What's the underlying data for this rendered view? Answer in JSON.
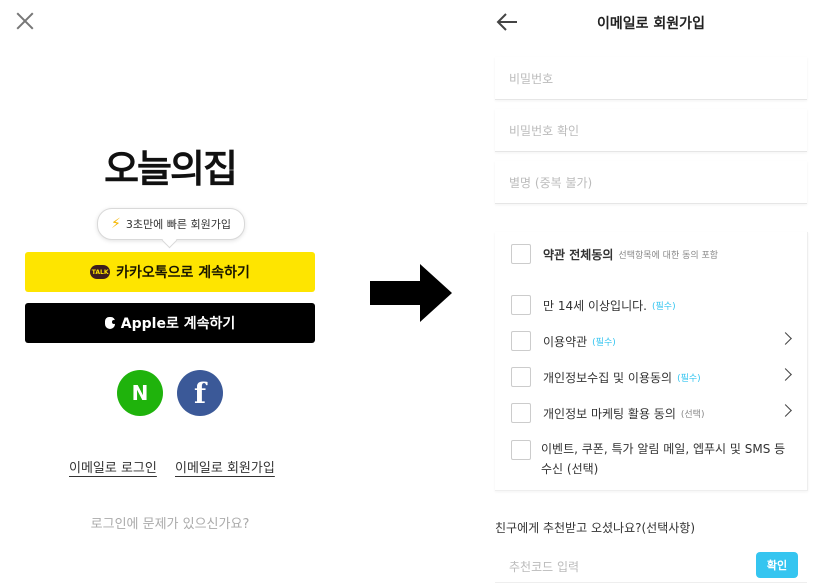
{
  "login": {
    "logo": "오늘의집",
    "bubble_text": "3초만에 빠른 회원가입",
    "kakao_icon_text": "TALK",
    "kakao_button": "카카오톡으로 계속하기",
    "apple_button": "Apple로 계속하기",
    "naver_letter": "N",
    "facebook_letter": "f",
    "email_login_link": "이메일로 로그인",
    "email_signup_link": "이메일로 회원가입",
    "trouble_text": "로그인에 문제가 있으신가요?"
  },
  "signup": {
    "title": "이메일로 회원가입",
    "fields": {
      "password": "비밀번호",
      "password_confirm": "비밀번호 확인",
      "nickname": "별명 (중복 불가)"
    },
    "terms": {
      "all_label": "약관 전체동의",
      "all_sub": "선택항목에 대한 동의 포함",
      "age_label": "만 14세 이상입니다.",
      "tos_label": "이용약관",
      "privacy_label": "개인정보수집 및 이용동의",
      "marketing_label": "개인정보 마케팅 활용 동의",
      "events_label_line1": "이벤트, 쿠폰, 특가 알림 메일, 엡푸시 및 SMS 등",
      "events_label_line2": "수신",
      "required_tag": "(필수)",
      "optional_tag": "(선택)"
    },
    "referral": {
      "label": "친구에게 추천받고 오셨나요?(선택사항)",
      "placeholder": "추천코드 입력",
      "confirm_button": "확인"
    }
  },
  "colors": {
    "kakao_yellow": "#fee500",
    "naver_green": "#1fb30c",
    "facebook_blue": "#3b5998",
    "accent_blue": "#35c5f0"
  }
}
